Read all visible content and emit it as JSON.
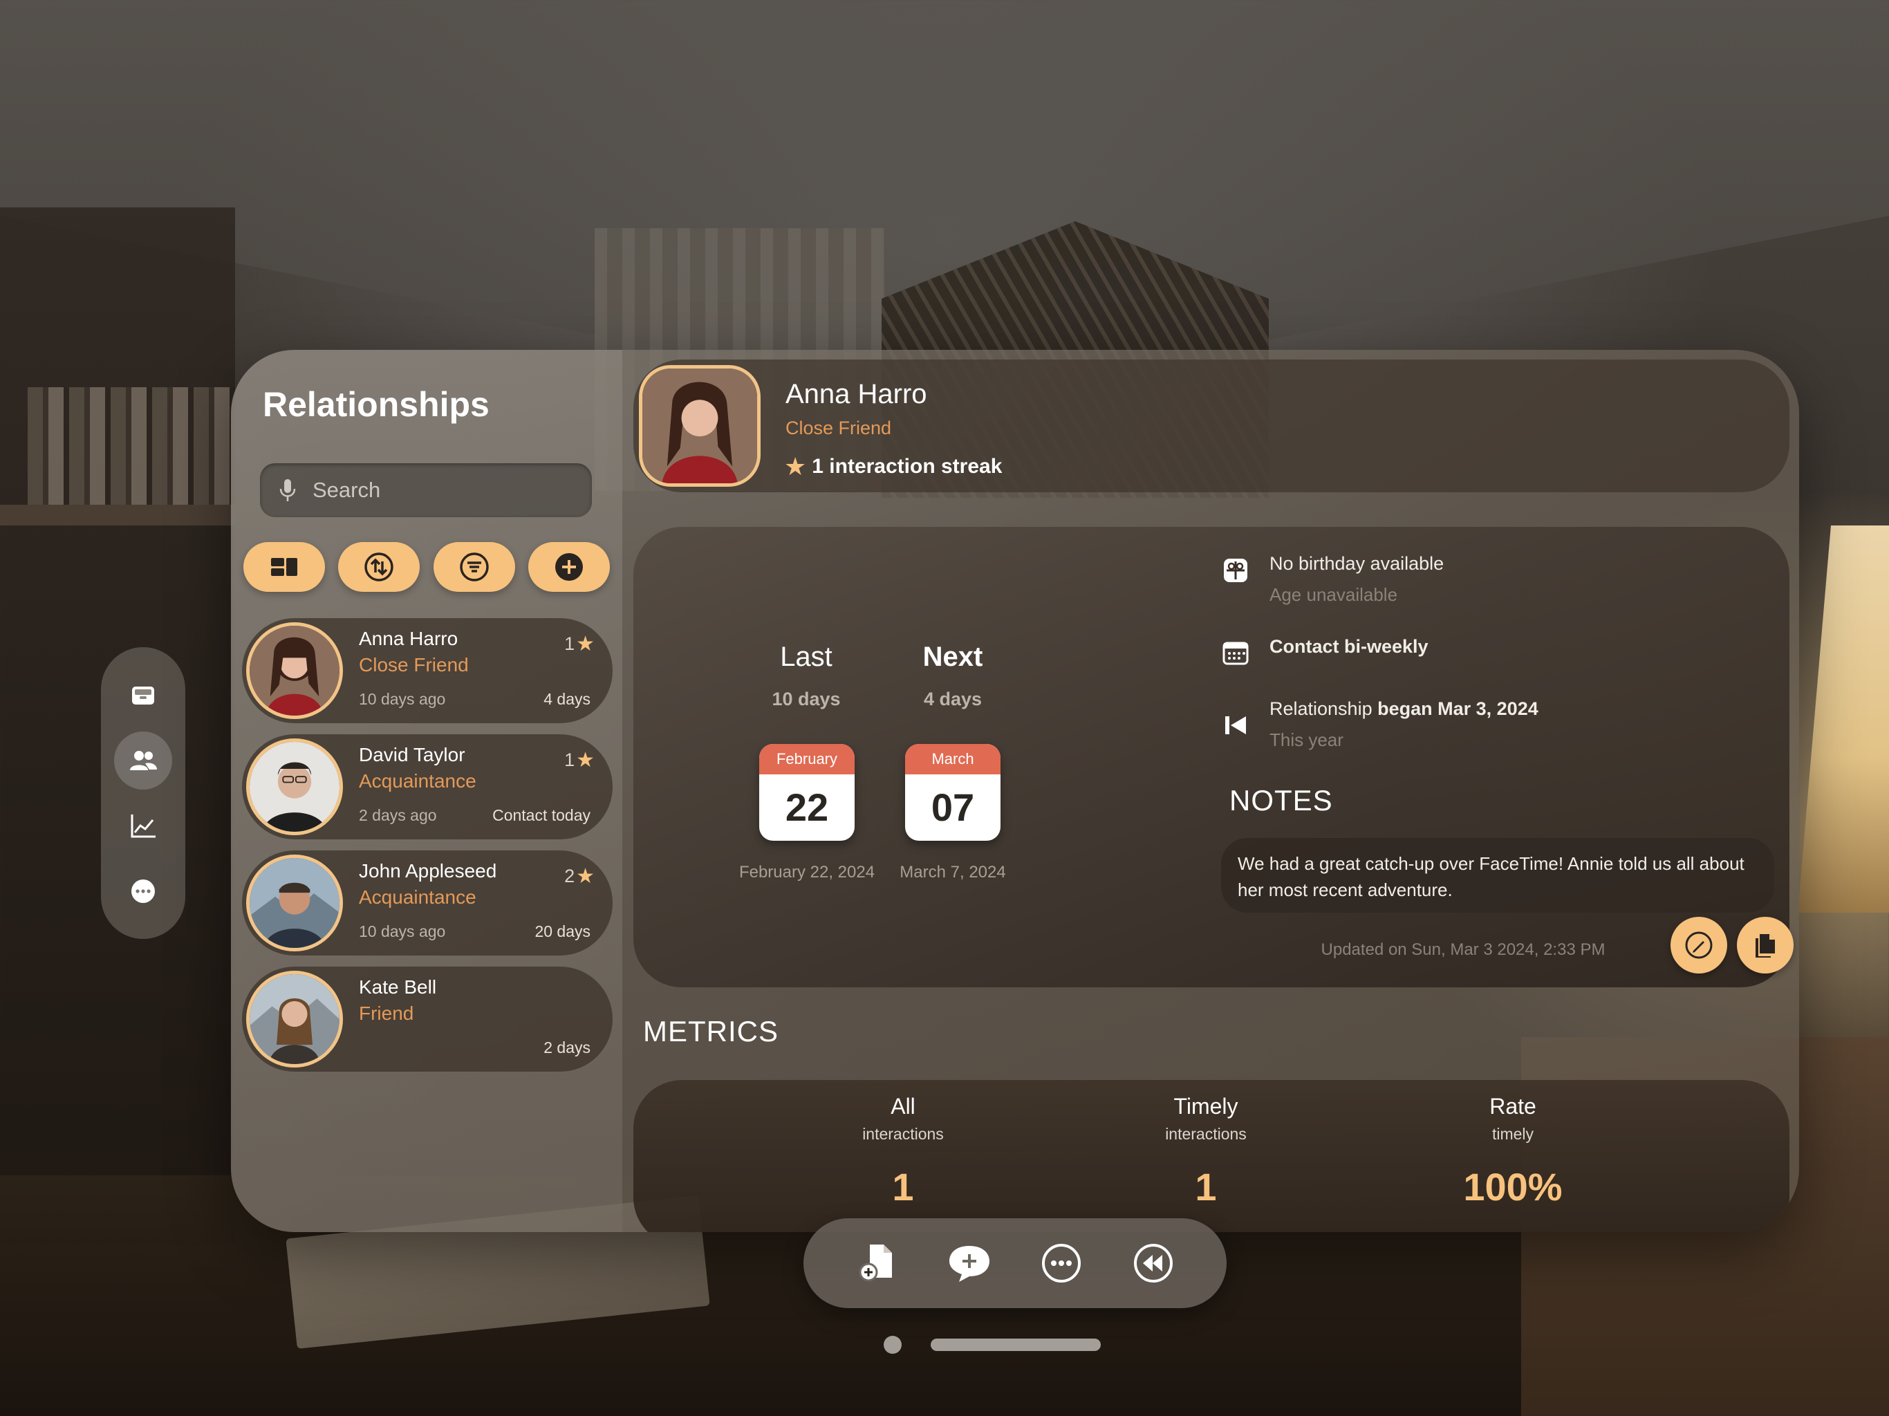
{
  "sidebar": {
    "title": "Relationships",
    "search_placeholder": "Search",
    "tools": [
      "layout-icon",
      "sort-icon",
      "filter-icon",
      "add-icon"
    ]
  },
  "ornament": {
    "items": [
      "inbox-tray-icon",
      "people-icon",
      "chart-line-icon",
      "more-ellipsis-icon"
    ],
    "active_index": 1
  },
  "contacts": [
    {
      "name": "Anna Harro",
      "relationship": "Close Friend",
      "last": "10 days ago",
      "due": "4 days",
      "streak": "1"
    },
    {
      "name": "David Taylor",
      "relationship": "Acquaintance",
      "last": "2 days ago",
      "due": "Contact today",
      "streak": "1"
    },
    {
      "name": "John Appleseed",
      "relationship": "Acquaintance",
      "last": "10 days ago",
      "due": "20 days",
      "streak": "2"
    },
    {
      "name": "Kate Bell",
      "relationship": "Friend",
      "last": "",
      "due": "2 days",
      "streak": ""
    }
  ],
  "detail": {
    "name": "Anna Harro",
    "relationship": "Close Friend",
    "streak_text": "1 interaction streak",
    "last_label": "Last",
    "last_sub": "10 days",
    "next_label": "Next",
    "next_sub": "4 days",
    "last_cal": {
      "month": "February",
      "day": "22",
      "date": "February 22, 2024"
    },
    "next_cal": {
      "month": "March",
      "day": "07",
      "date": "March 7, 2024"
    },
    "birthday_title": "No birthday available",
    "birthday_sub": "Age unavailable",
    "contact_freq": "Contact bi-weekly",
    "began_prefix": "Relationship",
    "began_bold": "began Mar 3, 2024",
    "began_sub": "This year",
    "notes_title": "NOTES",
    "note_text": "We had a great catch-up over FaceTime! Annie told us all about her most recent adventure.",
    "note_updated": "Updated on Sun, Mar 3 2024, 2:33 PM"
  },
  "metrics": {
    "title": "METRICS",
    "items": [
      {
        "title": "All",
        "sub": "interactions",
        "value": "1"
      },
      {
        "title": "Timely",
        "sub": "interactions",
        "value": "1"
      },
      {
        "title": "Rate",
        "sub": "timely",
        "value": "100%"
      }
    ]
  },
  "bottom_bar": [
    "add-document-icon",
    "add-message-icon",
    "more-icon",
    "rewind-icon"
  ],
  "colors": {
    "accent": "#f7c27e",
    "relationship_text": "#e49a58",
    "calendar_red": "#e16a52"
  }
}
